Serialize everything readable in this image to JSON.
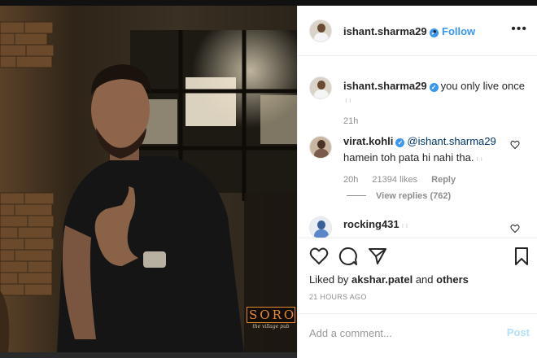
{
  "post": {
    "author": "ishant.sharma29",
    "follow_label": "Follow",
    "separator": "•",
    "more_icon": "more-horizontal-icon",
    "overlay_logo": {
      "main": "SORO",
      "sub": "the village pub"
    }
  },
  "caption": {
    "username": "ishant.sharma29",
    "text": "you only live once",
    "mark": "ı ı",
    "time": "21h"
  },
  "comments": [
    {
      "username": "virat.kohli",
      "mention": "@ishant.sharma29",
      "text": "hamein toh pata hi nahi tha.",
      "mark": "ı ı",
      "time": "20h",
      "likes": "21394 likes",
      "reply_label": "Reply",
      "view_replies": "View replies (762)"
    },
    {
      "username": "rocking431",
      "mark": "ı ı"
    }
  ],
  "actions": {
    "liked_prefix": "Liked by",
    "liked_user": "akshar.patel",
    "liked_and": "and",
    "liked_others": "others",
    "time_ago": "21 HOURS AGO"
  },
  "add_comment": {
    "placeholder": "Add a comment...",
    "post_label": "Post"
  },
  "colors": {
    "link_blue": "#3897f0",
    "post_disabled": "#b2dffc",
    "mention": "#003569",
    "logo_orange": "#e88a2c"
  }
}
